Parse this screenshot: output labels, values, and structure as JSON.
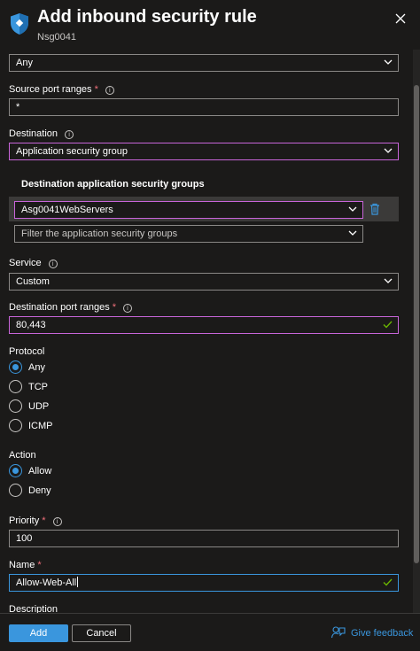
{
  "header": {
    "title": "Add inbound security rule",
    "subtitle": "Nsg0041"
  },
  "source": {
    "value": "Any"
  },
  "source_port_ranges": {
    "label": "Source port ranges",
    "value": "*"
  },
  "destination": {
    "label": "Destination",
    "value": "Application security group"
  },
  "destination_asg": {
    "section_title": "Destination application security groups",
    "selected": "Asg0041WebServers",
    "filter_placeholder": "Filter the application security groups"
  },
  "service": {
    "label": "Service",
    "value": "Custom"
  },
  "destination_port_ranges": {
    "label": "Destination port ranges",
    "value": "80,443"
  },
  "protocol": {
    "label": "Protocol",
    "options": [
      "Any",
      "TCP",
      "UDP",
      "ICMP"
    ],
    "selected": "Any"
  },
  "action": {
    "label": "Action",
    "options": [
      "Allow",
      "Deny"
    ],
    "selected": "Allow"
  },
  "priority": {
    "label": "Priority",
    "value": "100"
  },
  "name": {
    "label": "Name",
    "value": "Allow-Web-All"
  },
  "description": {
    "label": "Description"
  },
  "footer": {
    "add_label": "Add",
    "cancel_label": "Cancel",
    "feedback_label": "Give feedback"
  },
  "colors": {
    "background": "#1b1a19",
    "accent": "#3a96dd",
    "focus_border": "#c865d9",
    "required": "#f1707b",
    "valid_check": "#6bb700"
  }
}
